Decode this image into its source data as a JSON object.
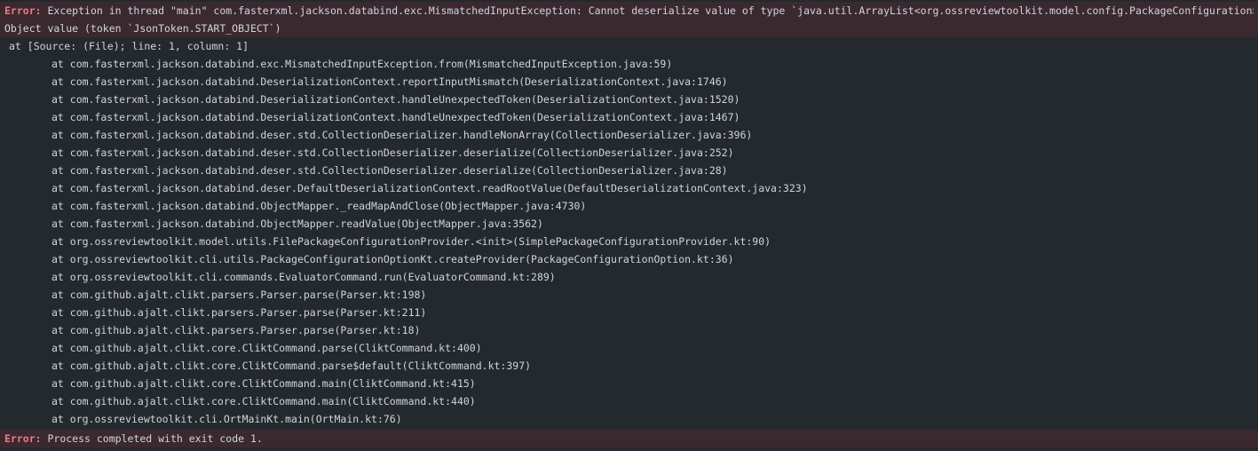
{
  "error_label": "Error:",
  "exception_line1": "Exception in thread \"main\" com.fasterxml.jackson.databind.exc.MismatchedInputException: Cannot deserialize value of type `java.util.ArrayList<org.ossreviewtoolkit.model.config.PackageConfiguration>` from",
  "exception_line2": "Object value (token `JsonToken.START_OBJECT`)",
  "source_line": "at [Source: (File); line: 1, column: 1]",
  "stack_frames": [
    "at com.fasterxml.jackson.databind.exc.MismatchedInputException.from(MismatchedInputException.java:59)",
    "at com.fasterxml.jackson.databind.DeserializationContext.reportInputMismatch(DeserializationContext.java:1746)",
    "at com.fasterxml.jackson.databind.DeserializationContext.handleUnexpectedToken(DeserializationContext.java:1520)",
    "at com.fasterxml.jackson.databind.DeserializationContext.handleUnexpectedToken(DeserializationContext.java:1467)",
    "at com.fasterxml.jackson.databind.deser.std.CollectionDeserializer.handleNonArray(CollectionDeserializer.java:396)",
    "at com.fasterxml.jackson.databind.deser.std.CollectionDeserializer.deserialize(CollectionDeserializer.java:252)",
    "at com.fasterxml.jackson.databind.deser.std.CollectionDeserializer.deserialize(CollectionDeserializer.java:28)",
    "at com.fasterxml.jackson.databind.deser.DefaultDeserializationContext.readRootValue(DefaultDeserializationContext.java:323)",
    "at com.fasterxml.jackson.databind.ObjectMapper._readMapAndClose(ObjectMapper.java:4730)",
    "at com.fasterxml.jackson.databind.ObjectMapper.readValue(ObjectMapper.java:3562)",
    "at org.ossreviewtoolkit.model.utils.FilePackageConfigurationProvider.<init>(SimplePackageConfigurationProvider.kt:90)",
    "at org.ossreviewtoolkit.cli.utils.PackageConfigurationOptionKt.createProvider(PackageConfigurationOption.kt:36)",
    "at org.ossreviewtoolkit.cli.commands.EvaluatorCommand.run(EvaluatorCommand.kt:289)",
    "at com.github.ajalt.clikt.parsers.Parser.parse(Parser.kt:198)",
    "at com.github.ajalt.clikt.parsers.Parser.parse(Parser.kt:211)",
    "at com.github.ajalt.clikt.parsers.Parser.parse(Parser.kt:18)",
    "at com.github.ajalt.clikt.core.CliktCommand.parse(CliktCommand.kt:400)",
    "at com.github.ajalt.clikt.core.CliktCommand.parse$default(CliktCommand.kt:397)",
    "at com.github.ajalt.clikt.core.CliktCommand.main(CliktCommand.kt:415)",
    "at com.github.ajalt.clikt.core.CliktCommand.main(CliktCommand.kt:440)",
    "at org.ossreviewtoolkit.cli.OrtMainKt.main(OrtMain.kt:76)"
  ],
  "final_message": "Process completed with exit code 1.",
  "colors": {
    "background": "#24292e",
    "error_highlight": "#3a2a30",
    "error_label": "#f97583",
    "text": "#d1d5da"
  }
}
